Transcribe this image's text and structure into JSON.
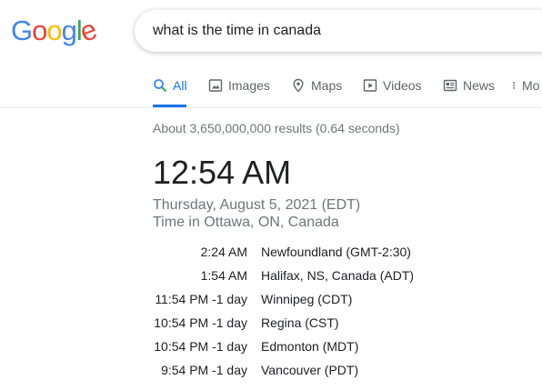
{
  "logo": {
    "letters": [
      "G",
      "o",
      "o",
      "g",
      "l",
      "e"
    ],
    "colors": [
      "#4285f4",
      "#ea4335",
      "#fbbc05",
      "#4285f4",
      "#34a853",
      "#ea4335"
    ]
  },
  "search": {
    "query": "what is the time in canada"
  },
  "tabs": [
    {
      "label": "All",
      "icon": "search-icon",
      "active": true
    },
    {
      "label": "Images",
      "icon": "image-icon",
      "active": false
    },
    {
      "label": "Maps",
      "icon": "map-pin-icon",
      "active": false
    },
    {
      "label": "Videos",
      "icon": "video-play-icon",
      "active": false
    },
    {
      "label": "News",
      "icon": "news-icon",
      "active": false
    },
    {
      "label": "Mo",
      "icon": "more-vert-icon",
      "active": false
    }
  ],
  "result_stats": "About 3,650,000,000 results (0.64 seconds)",
  "time_card": {
    "time": "12:54 AM",
    "date": "Thursday, August 5, 2021 (EDT)",
    "location": "Time in Ottawa, ON, Canada",
    "zones": [
      {
        "time": "2:24 AM",
        "place": "Newfoundland (GMT-2:30)"
      },
      {
        "time": "1:54 AM",
        "place": "Halifax, NS, Canada (ADT)"
      },
      {
        "time": "11:54 PM -1 day",
        "place": "Winnipeg (CDT)"
      },
      {
        "time": "10:54 PM -1 day",
        "place": "Regina (CST)"
      },
      {
        "time": "10:54 PM -1 day",
        "place": "Edmonton (MDT)"
      },
      {
        "time": "9:54 PM -1 day",
        "place": "Vancouver (PDT)"
      }
    ]
  },
  "colors": {
    "accent": "#1a73e8",
    "muted_text": "#70757a",
    "tab_text": "#5f6368"
  }
}
